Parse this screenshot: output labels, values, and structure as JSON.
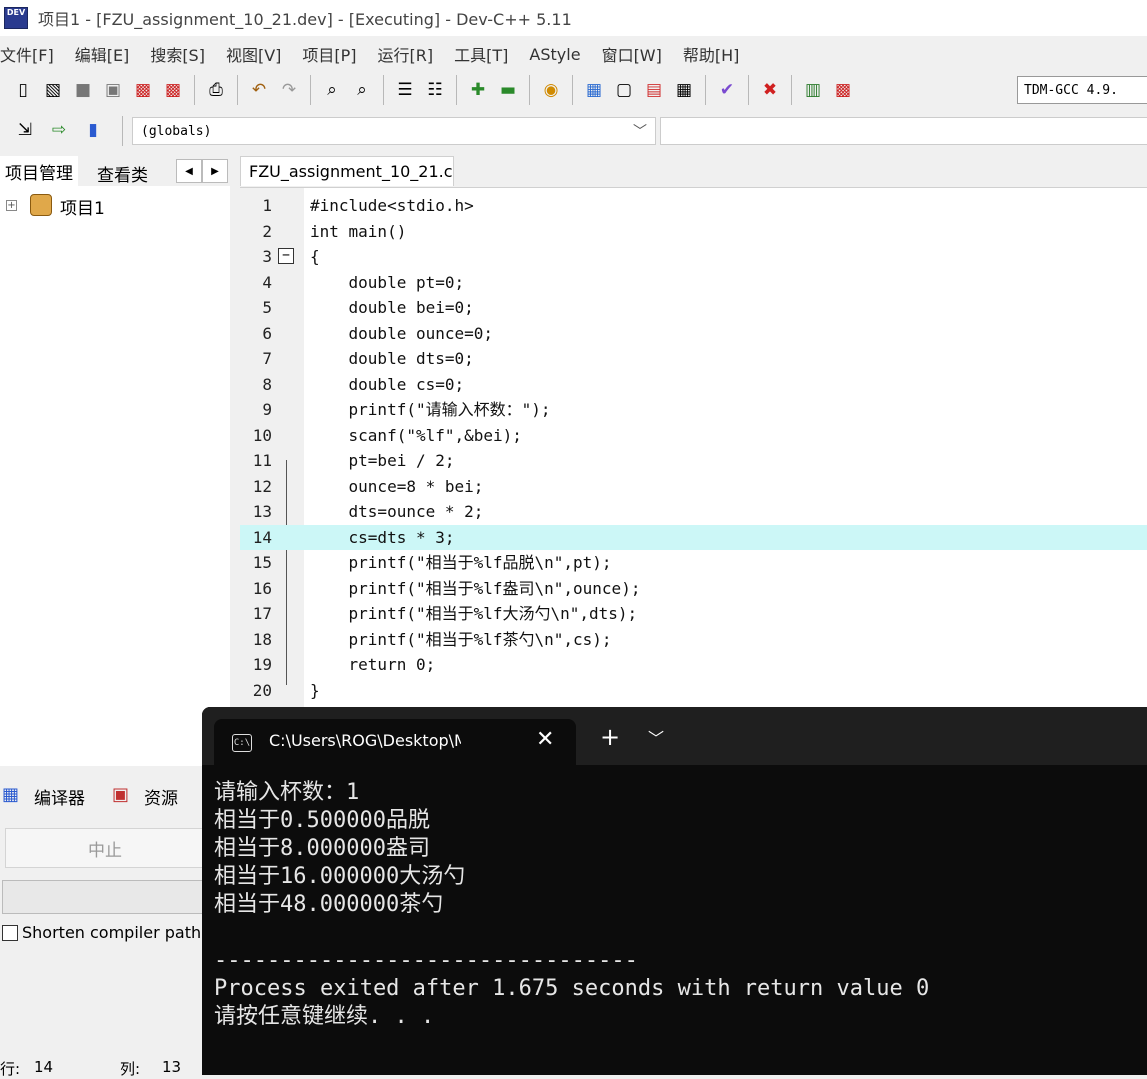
{
  "window": {
    "title": "项目1 - [FZU_assignment_10_21.dev] - [Executing] - Dev-C++ 5.11",
    "app_icon_label": "DEV"
  },
  "menu": [
    "文件[F]",
    "编辑[E]",
    "搜索[S]",
    "视图[V]",
    "项目[P]",
    "运行[R]",
    "工具[T]",
    "AStyle",
    "窗口[W]",
    "帮助[H]"
  ],
  "toolbar": {
    "compiler": "TDM-GCC 4.9.",
    "globals": "(globals)"
  },
  "left_panel": {
    "tabs": [
      "项目管理",
      "查看类"
    ],
    "tree_root": "项目1"
  },
  "editor": {
    "file_tab": "FZU_assignment_10_21.c",
    "highlighted_line": 14,
    "lines": [
      {
        "n": "1",
        "text": "#include<stdio.h>"
      },
      {
        "n": "2",
        "text": "int main()"
      },
      {
        "n": "3",
        "text": "{"
      },
      {
        "n": "4",
        "text": "    double pt=0;"
      },
      {
        "n": "5",
        "text": "    double bei=0;"
      },
      {
        "n": "6",
        "text": "    double ounce=0;"
      },
      {
        "n": "7",
        "text": "    double dts=0;"
      },
      {
        "n": "8",
        "text": "    double cs=0;"
      },
      {
        "n": "9",
        "text": "    printf(\"请输入杯数：\");"
      },
      {
        "n": "10",
        "text": "    scanf(\"%lf\",&bei);"
      },
      {
        "n": "11",
        "text": "    pt=bei / 2;"
      },
      {
        "n": "12",
        "text": "    ounce=8 * bei;"
      },
      {
        "n": "13",
        "text": "    dts=ounce * 2;"
      },
      {
        "n": "14",
        "text": "    cs=dts * 3;"
      },
      {
        "n": "15",
        "text": "    printf(\"相当于%lf品脱\\n\",pt);"
      },
      {
        "n": "16",
        "text": "    printf(\"相当于%lf盎司\\n\",ounce);"
      },
      {
        "n": "17",
        "text": "    printf(\"相当于%lf大汤勺\\n\",dts);"
      },
      {
        "n": "18",
        "text": "    printf(\"相当于%lf茶勺\\n\",cs);"
      },
      {
        "n": "19",
        "text": "    return 0;"
      },
      {
        "n": "20",
        "text": "}"
      }
    ]
  },
  "bottom_panel": {
    "tabs": [
      "编译器",
      "资源"
    ],
    "stop_button": "中止",
    "shorten_label": "Shorten compiler path",
    "status_row_label": "行:",
    "status_row_value": "14",
    "status_col_label": "列:",
    "status_col_value": "13"
  },
  "terminal": {
    "tab_title": "C:\\Users\\ROG\\Desktop\\MICHA",
    "icon_label": "C:\\",
    "lines": [
      "请输入杯数：1",
      "相当于0.500000品脱",
      "相当于8.000000盎司",
      "相当于16.000000大汤勺",
      "相当于48.000000茶勺",
      "",
      "--------------------------------",
      "Process exited after 1.675 seconds with return value 0",
      "请按任意键继续. . ."
    ]
  },
  "colors": {
    "highlight_line": "#ccf7f7",
    "terminal_bg": "#0c0c0c",
    "terminal_title_bg": "#1f1f1f"
  }
}
